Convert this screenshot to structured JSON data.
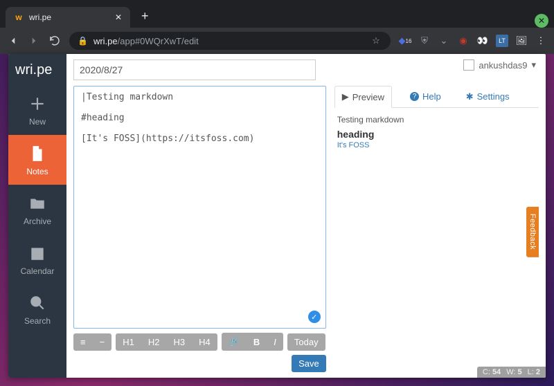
{
  "browser": {
    "tab_title": "wri.pe",
    "url_host": "wri.pe",
    "url_path": "/app#0WQrXwT/edit",
    "ext_badge": "16"
  },
  "user": {
    "name": "ankushdas9"
  },
  "app": {
    "brand": "wri.pe",
    "sidebar": [
      {
        "label": "New",
        "icon": "plus"
      },
      {
        "label": "Notes",
        "icon": "file"
      },
      {
        "label": "Archive",
        "icon": "folder"
      },
      {
        "label": "Calendar",
        "icon": "calendar"
      },
      {
        "label": "Search",
        "icon": "search"
      }
    ]
  },
  "note": {
    "title": "2020/8/27",
    "body": "|Testing markdown\n\n#heading\n\n[It's FOSS](https://itsfoss.com)"
  },
  "preview": {
    "tabs": {
      "preview": "Preview",
      "help": "Help",
      "settings": "Settings"
    },
    "text": "Testing markdown",
    "heading": "heading",
    "link_text": "It's FOSS",
    "link_href": "https://itsfoss.com"
  },
  "toolbar": {
    "h1": "H1",
    "h2": "H2",
    "h3": "H3",
    "h4": "H4",
    "today": "Today",
    "save": "Save"
  },
  "status": {
    "c_label": "C:",
    "c": "54",
    "w_label": "W:",
    "w": "5",
    "l_label": "L:",
    "l": "2"
  },
  "feedback": "Feedback"
}
